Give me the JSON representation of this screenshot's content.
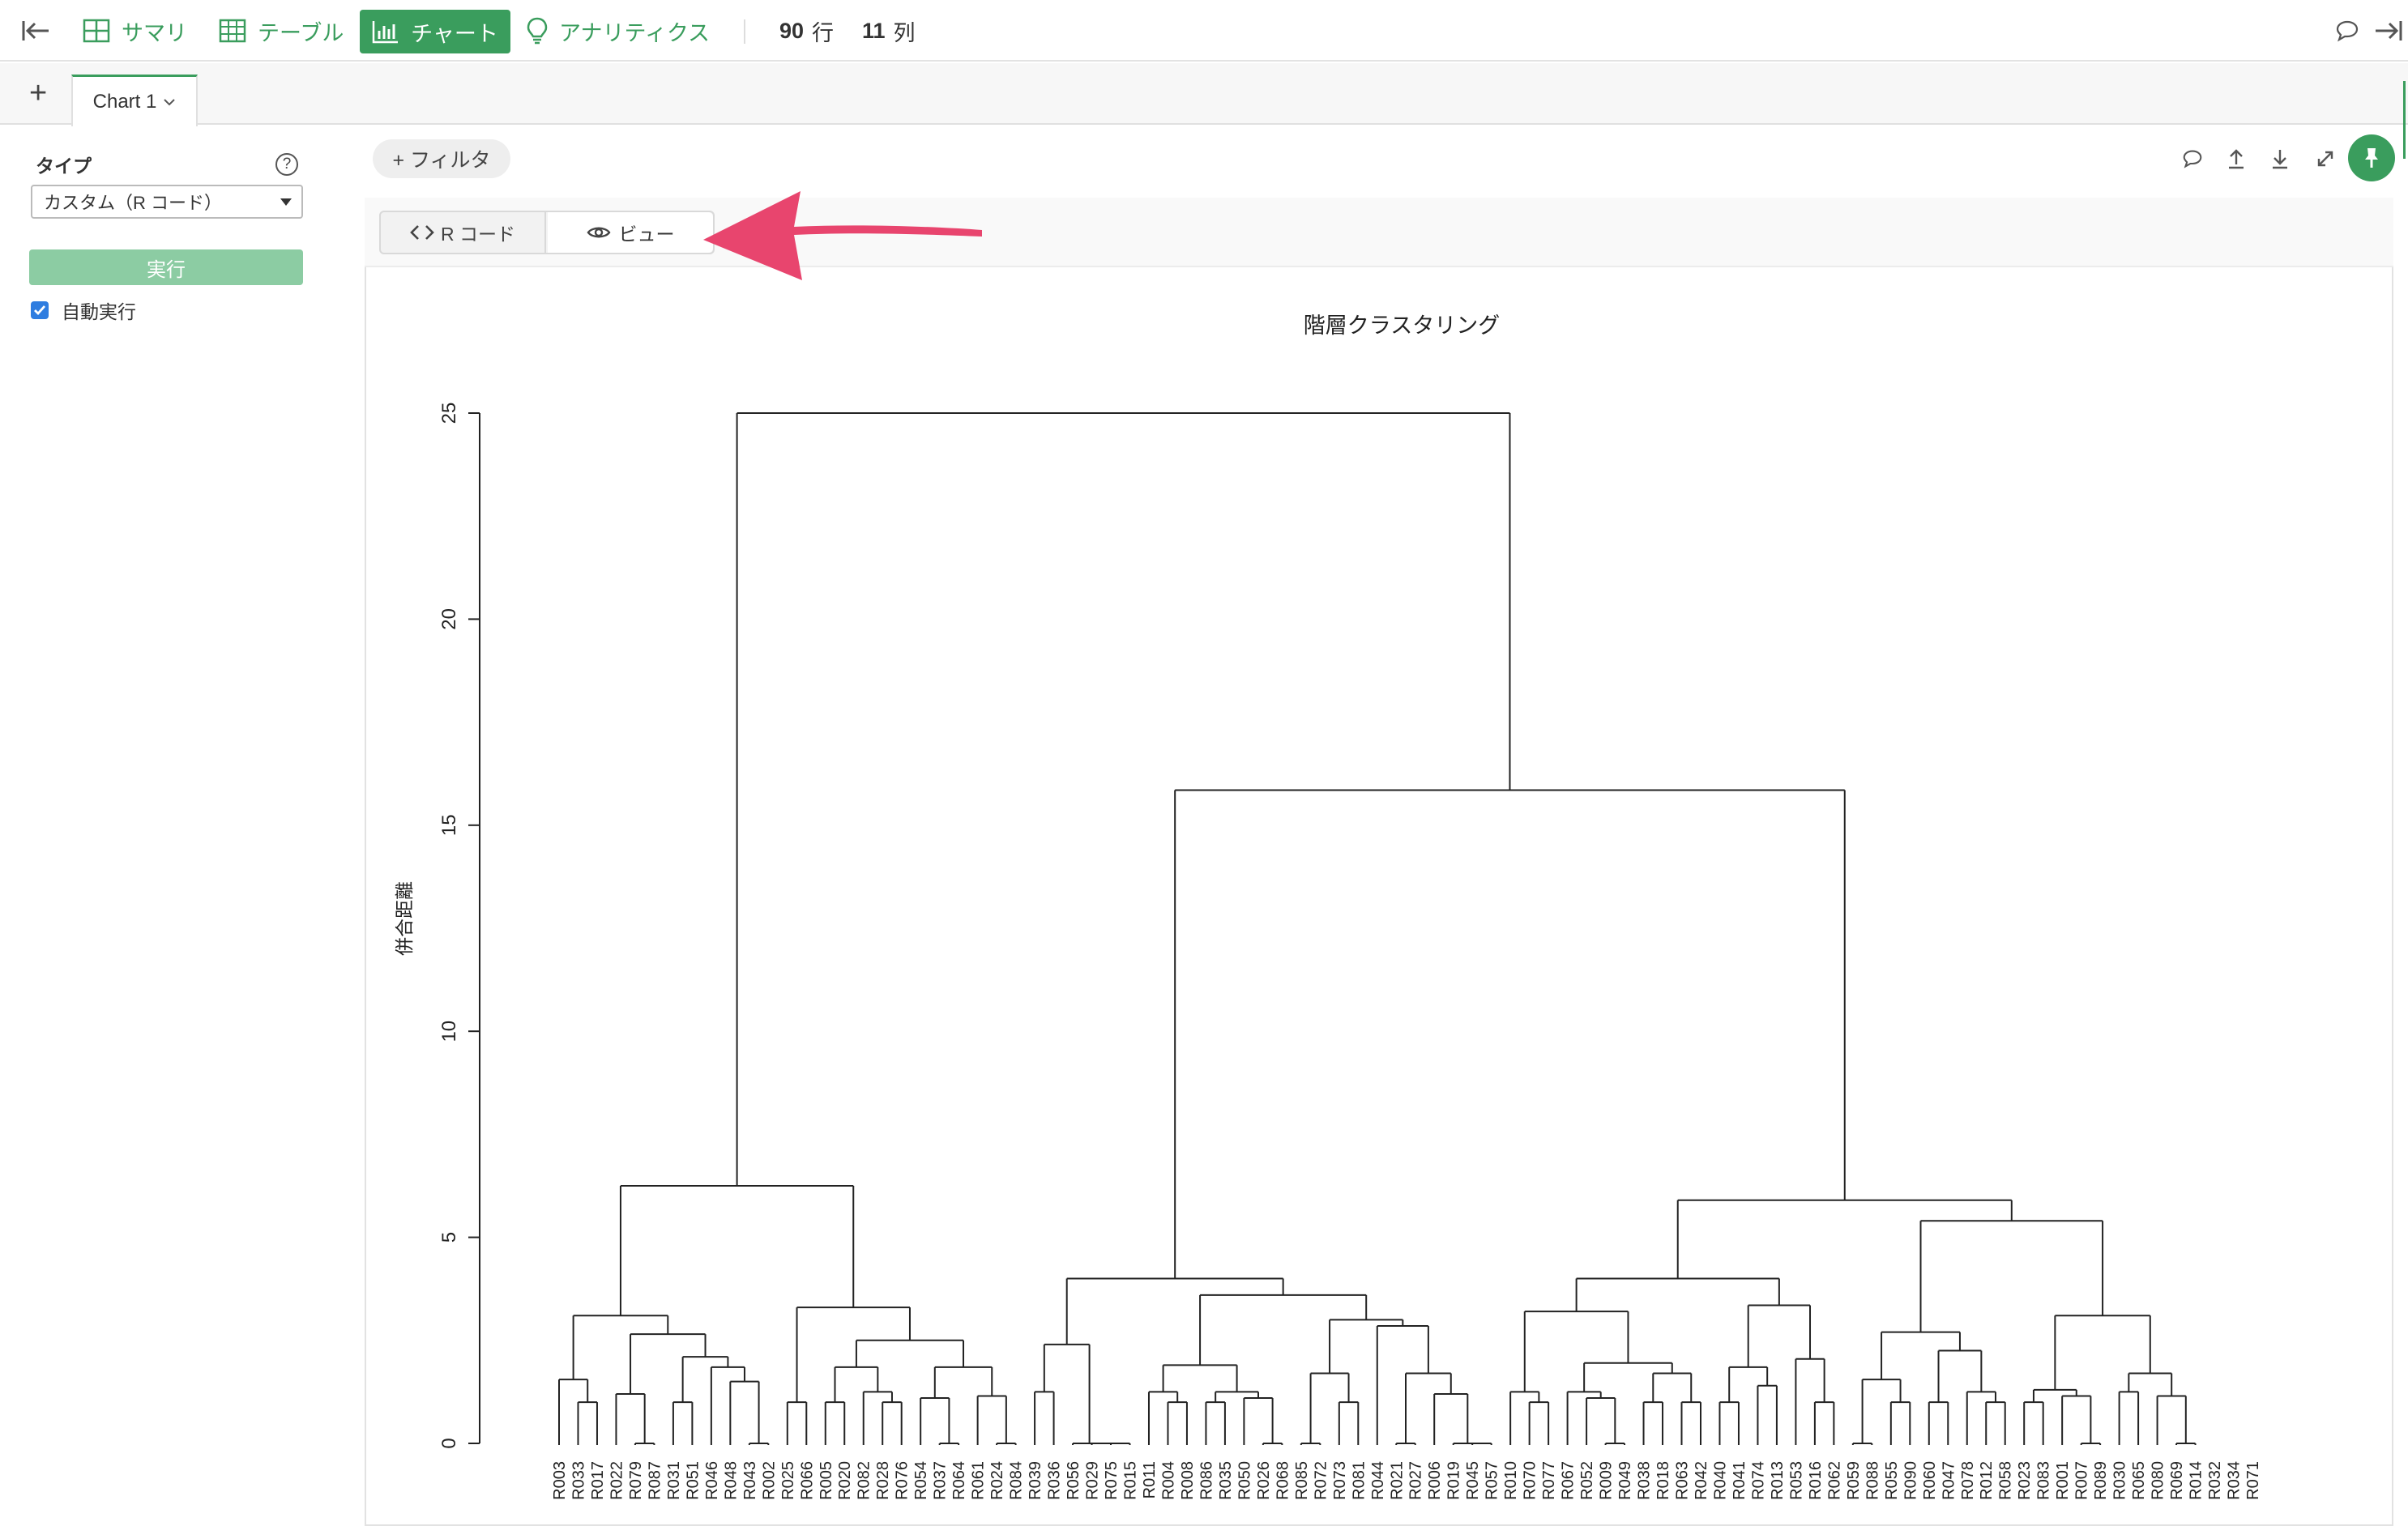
{
  "toolbar": {
    "summary": "サマリ",
    "table": "テーブル",
    "chart": "チャート",
    "analytics": "アナリティクス",
    "rows_count": "90",
    "rows_unit": "行",
    "cols_count": "11",
    "cols_unit": "列"
  },
  "tabs": {
    "add": "+",
    "chart1": "Chart 1"
  },
  "left_panel": {
    "type_label": "タイプ",
    "help": "?",
    "type_value": "カスタム（R コード）",
    "run": "実行",
    "auto_run": "自動実行"
  },
  "main": {
    "filter": "+ フィルタ",
    "tab_rcode": "R コード",
    "tab_view": "ビュー"
  },
  "colors": {
    "accent": "#3a9d5d",
    "arrow": "#e8456e"
  },
  "chart_data": {
    "type": "dendrogram",
    "title": "階層クラスタリング",
    "ylabel": "併合距離",
    "ylim": [
      0,
      25
    ],
    "yticks": [
      0,
      5,
      10,
      15,
      20,
      25
    ],
    "leaves": [
      "R003",
      "R033",
      "R017",
      "R022",
      "R079",
      "R087",
      "R031",
      "R051",
      "R046",
      "R048",
      "R043",
      "R002",
      "R025",
      "R066",
      "R005",
      "R020",
      "R082",
      "R028",
      "R076",
      "R054",
      "R037",
      "R064",
      "R061",
      "R024",
      "R084",
      "R039",
      "R036",
      "R056",
      "R029",
      "R075",
      "R015",
      "R011",
      "R004",
      "R008",
      "R086",
      "R035",
      "R050",
      "R026",
      "R068",
      "R085",
      "R072",
      "R073",
      "R081",
      "R044",
      "R021",
      "R027",
      "R006",
      "R019",
      "R045",
      "R057",
      "R010",
      "R070",
      "R077",
      "R067",
      "R052",
      "R009",
      "R049",
      "R038",
      "R018",
      "R063",
      "R042",
      "R040",
      "R041",
      "R074",
      "R013",
      "R053",
      "R016",
      "R062",
      "R059",
      "R088",
      "R055",
      "R090",
      "R060",
      "R047",
      "R078",
      "R012",
      "R058",
      "R023",
      "R083",
      "R001",
      "R007",
      "R089",
      "R030",
      "R065",
      "R080",
      "R069",
      "R014",
      "R032",
      "R034",
      "R071"
    ],
    "tree": [
      6.25,
      [
        3.1,
        [
          1.55,
          "R003",
          [
            1.0,
            "R033",
            "R017"
          ]
        ],
        [
          2.65,
          [
            1.2,
            "R022",
            [
              0.0,
              "R079",
              "R087"
            ]
          ],
          [
            2.1,
            [
              1.0,
              "R031",
              "R051"
            ],
            [
              1.85,
              "R046",
              [
                1.5,
                "R048",
                [
                  0.0,
                  "R043",
                  "R002"
                ]
              ]
            ]
          ]
        ]
      ],
      [
        3.3,
        [
          1.0,
          "R025",
          "R066"
        ],
        [
          2.5,
          [
            1.85,
            [
              1.0,
              "R005",
              "R020"
            ],
            [
              1.25,
              "R082",
              [
                1.0,
                "R028",
                "R076"
              ]
            ]
          ],
          [
            1.85,
            [
              1.1,
              "R054",
              [
                0.0,
                "R037",
                "R064"
              ]
            ],
            [
              1.15,
              "R061",
              [
                0.0,
                "R024",
                "R084"
              ]
            ]
          ]
        ]
      ]
    ],
    "tree_right": [
      25.0,
      null,
      [
        15.85,
        [
          4.0,
          [
            2.4,
            [
              1.25,
              "R039",
              "R036"
            ],
            [
              0.0,
              "R056",
              [
                0.0,
                "R029",
                [
                  0.0,
                  "R075",
                  "R015"
                ]
              ]
            ]
          ],
          [
            3.6,
            [
              1.9,
              [
                1.25,
                "R011",
                [
                  1.0,
                  "R004",
                  "R008"
                ]
              ],
              [
                1.25,
                [
                  1.0,
                  "R086",
                  "R035"
                ],
                [
                  1.1,
                  "R050",
                  [
                    0.0,
                    "R026",
                    "R068"
                  ]
                ]
              ]
            ],
            [
              3.0,
              [
                1.7,
                [
                  0.0,
                  "R085",
                  "R072"
                ],
                [
                  1.0,
                  "R073",
                  "R081"
                ]
              ],
              [
                2.85,
                "R044",
                [
                  1.7,
                  [
                    0.0,
                    "R021",
                    "R027"
                  ],
                  [
                    1.2,
                    "R006",
                    [
                      0.0,
                      "R019",
                      [
                        0.0,
                        "R045",
                        "R057"
                      ]
                    ]
                  ]
                ]
              ]
            ]
          ]
        ],
        [
          5.9,
          [
            4.0,
            [
              3.2,
              [
                1.25,
                "R010",
                [
                  1.0,
                  "R070",
                  "R077"
                ]
              ],
              [
                1.95,
                [
                  1.25,
                  "R067",
                  [
                    1.1,
                    "R052",
                    [
                      0.0,
                      "R009",
                      "R049"
                    ]
                  ]
                ],
                [
                  1.7,
                  [
                    1.0,
                    "R038",
                    "R018"
                  ],
                  [
                    1.0,
                    "R063",
                    "R042"
                  ]
                ]
              ]
            ],
            [
              3.35,
              [
                1.85,
                [
                  1.0,
                  "R040",
                  "R041"
                ],
                [
                  1.4,
                  "R074",
                  "R013"
                ]
              ],
              [
                2.05,
                "R053",
                [
                  1.0,
                  "R016",
                  "R062"
                ]
              ]
            ]
          ],
          [
            5.4,
            [
              2.7,
              [
                1.55,
                [
                  0.0,
                  "R059",
                  "R088"
                ],
                [
                  1.0,
                  "R055",
                  "R090"
                ]
              ],
              [
                2.25,
                [
                  1.0,
                  "R060",
                  "R047"
                ],
                [
                  1.25,
                  "R078",
                  [
                    1.0,
                    "R012",
                    "R058"
                  ]
                ]
              ]
            ],
            [
              3.1,
              [
                1.3,
                [
                  1.0,
                  "R023",
                  "R083"
                ],
                [
                  1.15,
                  "R001",
                  [
                    0.0,
                    "R007",
                    "R089"
                  ]
                ]
              ],
              [
                1.7,
                [
                  1.25,
                  "R030",
                  "R065"
                ],
                [
                  1.15,
                  "R080",
                  [
                    0.0,
                    "R069",
                    "R014"
                  ]
                ]
              ]
            ]
          ]
        ]
      ]
    ]
  }
}
